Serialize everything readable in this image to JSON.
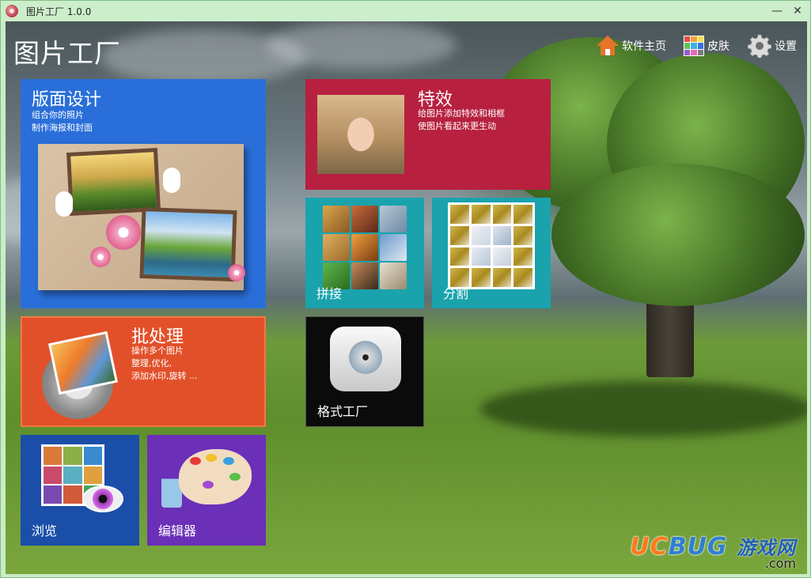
{
  "window": {
    "title": "图片工厂 1.0.0",
    "minimize_glyph": "—",
    "close_glyph": "✕"
  },
  "app": {
    "heading": "图片工厂"
  },
  "topnav": {
    "home_label": "软件主页",
    "skin_label": "皮肤",
    "settings_label": "设置"
  },
  "tiles": {
    "layout": {
      "title": "版面设计",
      "desc1": "组合你的照片",
      "desc2": "制作海报和封面",
      "color": "#2a6fd9"
    },
    "effects": {
      "title": "特效",
      "desc1": "给图片添加特效和相框",
      "desc2": "使图片看起来更生动",
      "color": "#b7203f"
    },
    "splice": {
      "label": "拼接",
      "color": "#1aa3ad"
    },
    "split": {
      "label": "分割",
      "color": "#1aa3ad"
    },
    "batch": {
      "title": "批处理",
      "desc1": "操作多个图片",
      "desc2": "整理,优化,",
      "desc3": "添加水印,旋转 ...",
      "color": "#e2502a"
    },
    "format": {
      "label": "格式工厂",
      "color": "#0b0b0b"
    },
    "browse": {
      "label": "浏览",
      "color": "#1a4ea8"
    },
    "editor": {
      "label": "编辑器",
      "color": "#6b2fb8"
    }
  },
  "icons": {
    "app": "app-flower-icon",
    "home": "home-icon",
    "skin": "skin-palette-icon",
    "settings": "gear-icon"
  },
  "watermark": {
    "brand_a": "UC",
    "brand_b": "BUG",
    "cn": "游戏网",
    "domain": ".com"
  }
}
